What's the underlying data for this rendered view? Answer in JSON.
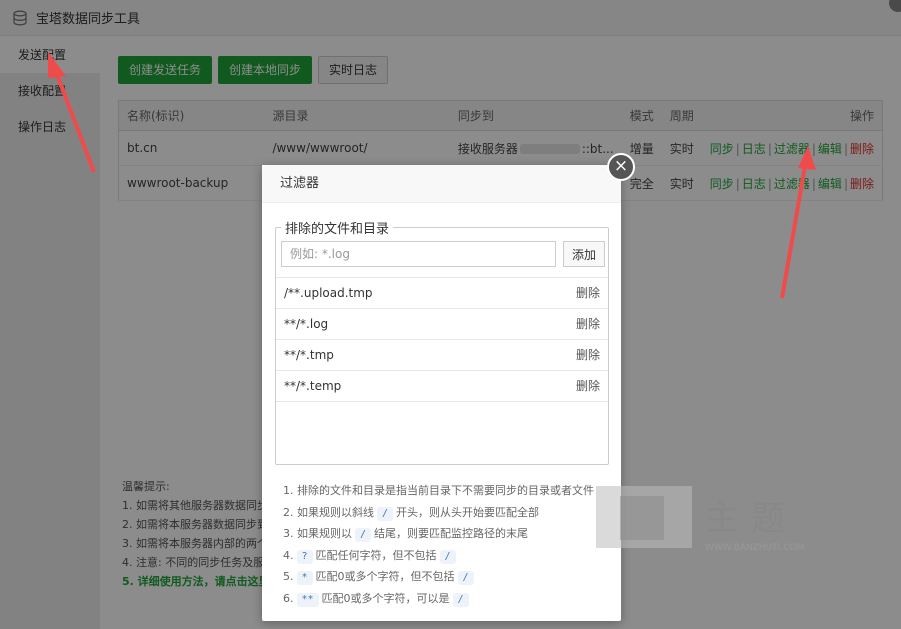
{
  "window": {
    "title": "宝塔数据同步工具"
  },
  "sidebar": {
    "items": [
      {
        "label": "发送配置"
      },
      {
        "label": "接收配置"
      },
      {
        "label": "操作日志"
      }
    ]
  },
  "toolbar": {
    "create_send": "创建发送任务",
    "create_local": "创建本地同步",
    "realtime_log": "实时日志"
  },
  "table": {
    "headers": {
      "name": "名称(标识)",
      "source": "源目录",
      "sync_to": "同步到",
      "mode": "模式",
      "period": "周期",
      "ops": "操作"
    },
    "rows": [
      {
        "name": "bt.cn",
        "source": "/www/wwwroot/",
        "sync_to_prefix": "接收服务器",
        "sync_to_suffix": "::bt...",
        "mode": "增量",
        "period": "实时"
      },
      {
        "name": "wwwroot-backup",
        "source": "",
        "sync_to_prefix": "",
        "sync_to_suffix": "",
        "mode": "完全",
        "period": "实时"
      }
    ],
    "ops": {
      "sync": "同步",
      "log": "日志",
      "filter": "过滤器",
      "edit": "编辑",
      "delete": "删除"
    }
  },
  "tips": {
    "title": "温馨提示:",
    "lines": [
      "1. 如需将其他服务器数据同步",
      "2. 如需将本服务器数据同步到",
      "3. 如需将本服务器内部的两个",
      "4. 注意: 不同的同步任务及服",
      "5. 详细使用方法，请点击这里"
    ]
  },
  "modal": {
    "title": "过滤器",
    "close_symbol": "×",
    "legend": "排除的文件和目录",
    "input_placeholder": "例如: *.log",
    "add_button": "添加",
    "remove_label": "删除",
    "rules": [
      "/**.upload.tmp",
      "**/*.log",
      "**/*.tmp",
      "**/*.temp"
    ],
    "help": {
      "line1": "1. 排除的文件和目录是指当前目录下不需要同步的目录或者文件",
      "line2": {
        "pre": "2. 如果规则以斜线",
        "code": "/",
        "post": "开头，则从头开始要匹配全部"
      },
      "line3": {
        "pre": "3. 如果规则以",
        "code": "/",
        "post": "结尾，则要匹配监控路径的末尾"
      },
      "line4": {
        "pre": "4.",
        "code": "?",
        "mid": "匹配任何字符，但不包括",
        "code2": "/"
      },
      "line5": {
        "pre": "5.",
        "code": "*",
        "mid": "匹配0或多个字符，但不包括",
        "code2": "/"
      },
      "line6": {
        "pre": "6.",
        "code": "**",
        "mid": "匹配0或多个字符，可以是",
        "code2": "/"
      }
    }
  },
  "watermark": {
    "cn": "主题",
    "site": "WWW.BANZHUTI.COM"
  },
  "colors": {
    "accent": "#20a53a",
    "danger": "#e0322d",
    "annotation_arrow": "#f04b4b"
  }
}
